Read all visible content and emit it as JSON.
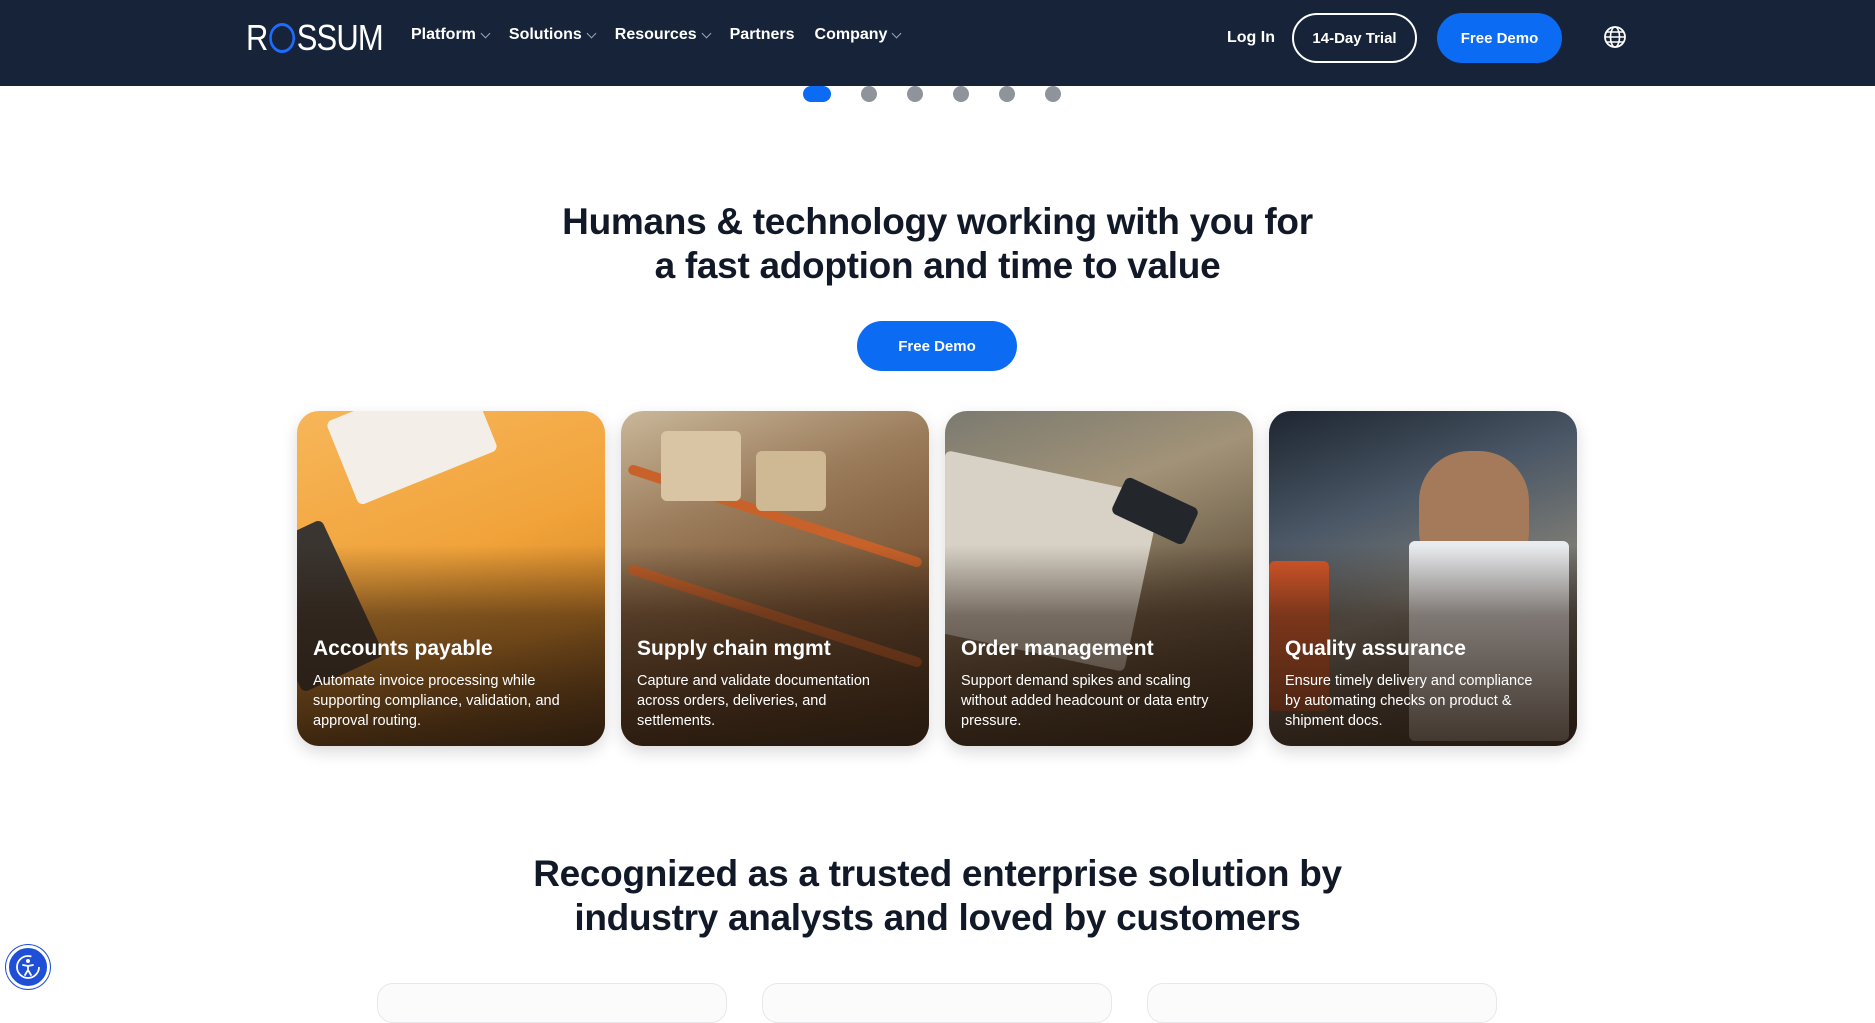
{
  "brand": {
    "logo_prefix": "R",
    "logo_suffix": "SSUM",
    "accent": "#0b6bf2",
    "header_bg": "#162338"
  },
  "nav": {
    "items": [
      {
        "label": "Platform",
        "has_dropdown": true
      },
      {
        "label": "Solutions",
        "has_dropdown": true
      },
      {
        "label": "Resources",
        "has_dropdown": true
      },
      {
        "label": "Partners",
        "has_dropdown": false
      },
      {
        "label": "Company",
        "has_dropdown": true
      }
    ],
    "login": "Log In",
    "trial": "14-Day Trial",
    "demo": "Free Demo",
    "language_icon": "globe-icon"
  },
  "carousel": {
    "dot_count": 6,
    "active_index": 0
  },
  "hero": {
    "line1": "Humans & technology working with you for",
    "line2": "a fast adoption and time to value",
    "cta": "Free Demo"
  },
  "cards": [
    {
      "title": "Accounts payable",
      "desc": "Automate invoice processing while supporting compliance, validation, and approval routing."
    },
    {
      "title": "Supply chain mgmt",
      "desc": "Capture and validate documentation across orders, deliveries, and settlements."
    },
    {
      "title": "Order management",
      "desc": "Support demand spikes and scaling without added headcount or data entry pressure."
    },
    {
      "title": "Quality assurance",
      "desc": "Ensure timely delivery and compliance by automating checks on product & shipment docs."
    }
  ],
  "recognized": {
    "line1": "Recognized as a trusted enterprise solution by",
    "line2": "industry analysts and loved by customers"
  },
  "accessibility": {
    "icon": "accessibility-icon"
  }
}
